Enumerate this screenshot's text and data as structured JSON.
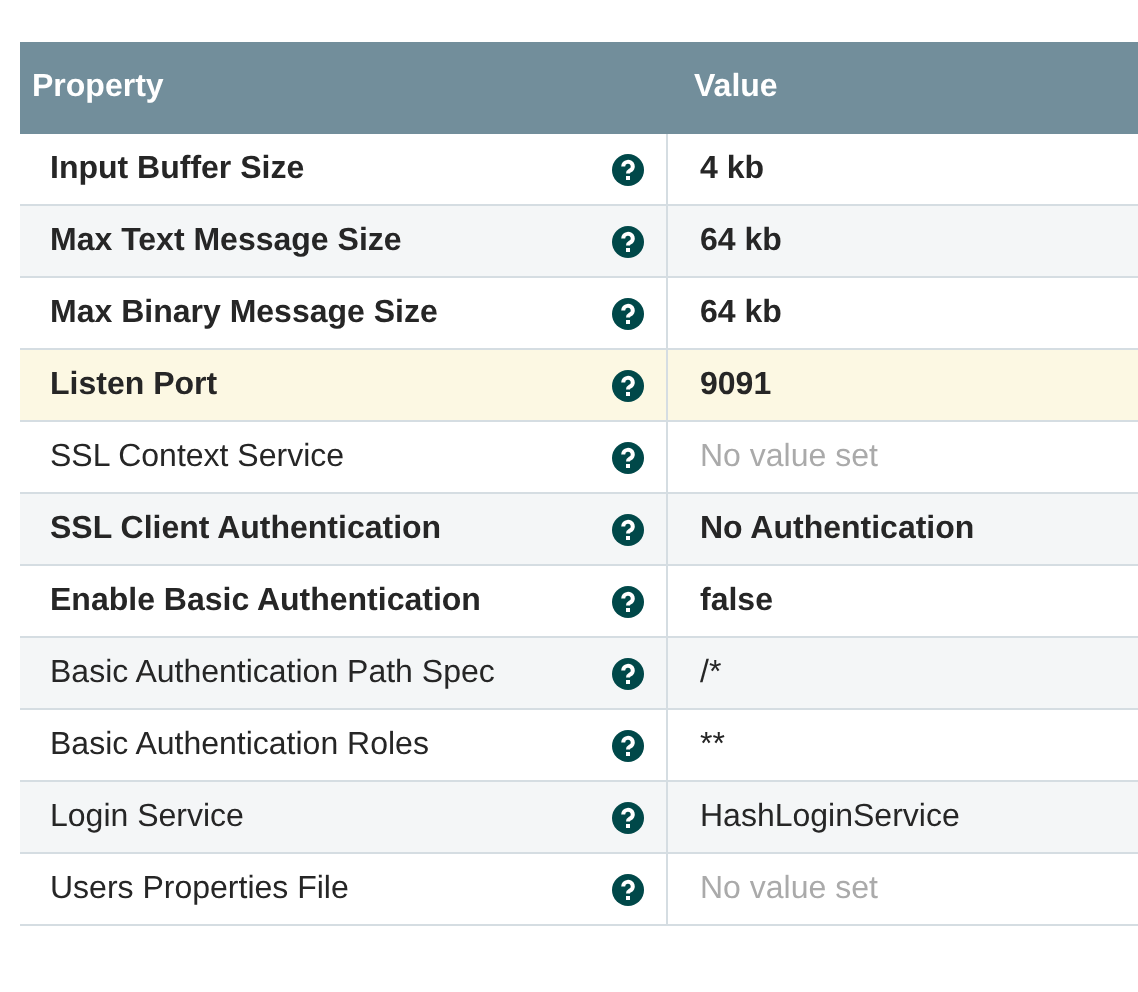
{
  "table": {
    "columns": [
      "Property",
      "Value"
    ],
    "rows": [
      {
        "property": "Input Buffer Size",
        "value": "4 kb",
        "required": true,
        "value_set": true,
        "selected": false
      },
      {
        "property": "Max Text Message Size",
        "value": "64 kb",
        "required": true,
        "value_set": true,
        "selected": false
      },
      {
        "property": "Max Binary Message Size",
        "value": "64 kb",
        "required": true,
        "value_set": true,
        "selected": false
      },
      {
        "property": "Listen Port",
        "value": "9091",
        "required": true,
        "value_set": true,
        "selected": true
      },
      {
        "property": "SSL Context Service",
        "value": "No value set",
        "required": false,
        "value_set": false,
        "selected": false
      },
      {
        "property": "SSL Client Authentication",
        "value": "No Authentication",
        "required": true,
        "value_set": true,
        "selected": false
      },
      {
        "property": "Enable Basic Authentication",
        "value": "false",
        "required": true,
        "value_set": true,
        "selected": false
      },
      {
        "property": "Basic Authentication Path Spec",
        "value": "/*",
        "required": false,
        "value_set": true,
        "selected": false
      },
      {
        "property": "Basic Authentication Roles",
        "value": "**",
        "required": false,
        "value_set": true,
        "selected": false
      },
      {
        "property": "Login Service",
        "value": "HashLoginService",
        "required": false,
        "value_set": true,
        "selected": false
      },
      {
        "property": "Users Properties File",
        "value": "No value set",
        "required": false,
        "value_set": false,
        "selected": false
      }
    ]
  }
}
